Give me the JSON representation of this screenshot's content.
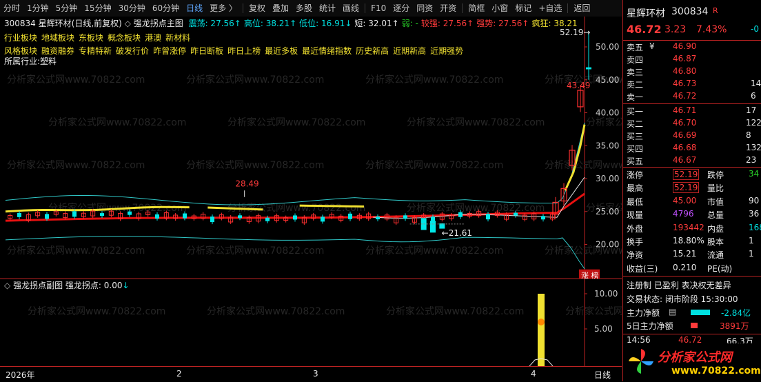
{
  "toolbar": {
    "items": [
      "分时",
      "1分钟",
      "5分钟",
      "15分钟",
      "30分钟",
      "60分钟",
      "日线",
      "更多 〉",
      "复权",
      "叠加",
      "多股",
      "统计",
      "画线",
      "F10",
      "逐分",
      "同资",
      "开资",
      "简框",
      "小窗",
      "标记",
      "+自选",
      "返回"
    ],
    "active": "日线"
  },
  "main_chart": {
    "title_code": "300834",
    "title_name": "星辉环材",
    "title_mode": "(日线,前复权)",
    "indicator_name": "强龙拐点主图",
    "legend": [
      {
        "label": "震荡:",
        "value": "27.56",
        "arrow": "↑",
        "color": "#00e0e0"
      },
      {
        "label": "高位:",
        "value": "38.21",
        "arrow": "↑",
        "color": "#00e0e0"
      },
      {
        "label": "低位:",
        "value": "16.91",
        "arrow": "↓",
        "color": "#00e0e0"
      },
      {
        "label": "短:",
        "value": "32.01",
        "arrow": "↑",
        "color": "#e8e8e8"
      },
      {
        "label": "弱:",
        "value": "-",
        "arrow": "",
        "color": "#28d028"
      },
      {
        "label": "较强:",
        "value": "27.56",
        "arrow": "↑",
        "color": "#ff3b3b"
      },
      {
        "label": "强势:",
        "value": "27.56",
        "arrow": "↑",
        "color": "#ff3b3b"
      },
      {
        "label": "疯狂:",
        "value": "38.21",
        "arrow": "",
        "color": "#f0e030"
      }
    ],
    "info_line1": [
      "行业板块",
      "地域板块",
      "东板块",
      "概念板块",
      "港澳",
      "新材料"
    ],
    "info_line2": [
      "风格板块",
      "融资融券",
      "专精特新",
      "破发行价",
      "昨曾涨停",
      "昨日断板",
      "昨日上榜",
      "最近多板",
      "最近情绪指数",
      "历史新高",
      "近期新高",
      "近期强势"
    ],
    "industry": "所属行业:塑料",
    "y_ticks": [
      "50.00",
      "45.00",
      "40.00",
      "35.00",
      "30.00",
      "25.00",
      "20.00"
    ],
    "annotations": {
      "high_label": "52.19",
      "peak1": "28.49",
      "low_label": "21.61",
      "red_label": "43.49",
      "badge": "涨 榜"
    }
  },
  "sub_chart": {
    "name": "强龙拐点副图",
    "label": "强龙拐点:",
    "value": "0.00",
    "arrow": "↓",
    "y_ticks": [
      "10.00",
      "5.00"
    ]
  },
  "time_axis": {
    "labels": [
      "2026年",
      "2",
      "3",
      "4"
    ],
    "period_button": "日线"
  },
  "watermark": "分析家公式网www.70822.com",
  "logo_text": "分析家公式网",
  "logo_url": "www.70822.com",
  "quote": {
    "name": "星辉环材",
    "code": "300834",
    "flag": "R",
    "price": "46.72",
    "change": "3.23",
    "pct": "7.43%",
    "corner": "-0",
    "asks": [
      {
        "label": "卖五",
        "mark": "¥",
        "price": "46.90",
        "vol": ""
      },
      {
        "label": "卖四",
        "mark": "",
        "price": "46.87",
        "vol": ""
      },
      {
        "label": "卖三",
        "mark": "",
        "price": "46.80",
        "vol": ""
      },
      {
        "label": "卖二",
        "mark": "",
        "price": "46.73",
        "vol": "14"
      },
      {
        "label": "卖一",
        "mark": "",
        "price": "46.72",
        "vol": "6"
      }
    ],
    "bids": [
      {
        "label": "买一",
        "price": "46.71",
        "vol": "17"
      },
      {
        "label": "买二",
        "price": "46.70",
        "vol": "122"
      },
      {
        "label": "买三",
        "price": "46.69",
        "vol": "8"
      },
      {
        "label": "买四",
        "price": "46.68",
        "vol": "132"
      },
      {
        "label": "买五",
        "price": "46.67",
        "vol": "23"
      }
    ],
    "stats": [
      {
        "l1": "涨停",
        "v1": "52.19",
        "c1": "#ff3b3b",
        "l2": "跌停",
        "v2": "34",
        "c2": "#28d028"
      },
      {
        "l1": "最高",
        "v1": "52.19",
        "c1": "#ff3b3b",
        "l2": "量比",
        "v2": "",
        "c2": "#e8e8e8"
      },
      {
        "l1": "最低",
        "v1": "45.00",
        "c1": "#ff3b3b",
        "l2": "市值",
        "v2": "90",
        "c2": "#e8e8e8"
      },
      {
        "l1": "现量",
        "v1": "4796",
        "c1": "#c050ff",
        "l2": "总量",
        "v2": "36",
        "c2": "#e8e8e8"
      },
      {
        "l1": "外盘",
        "v1": "193442",
        "c1": "#ff3b3b",
        "l2": "内盘",
        "v2": "168",
        "c2": "#00e0e0"
      },
      {
        "l1": "换手",
        "v1": "18.80%",
        "c1": "#e8e8e8",
        "l2": "股本",
        "v2": "1",
        "c2": "#e8e8e8"
      },
      {
        "l1": "净资",
        "v1": "15.21",
        "c1": "#e8e8e8",
        "l2": "流通",
        "v2": "1",
        "c2": "#e8e8e8"
      },
      {
        "l1": "收益(三)",
        "v1": "0.210",
        "c1": "#e8e8e8",
        "l2": "PE(动)",
        "v2": "",
        "c2": "#e8e8e8"
      }
    ],
    "tags": "注册制 已盈利 表决权无差异",
    "status": "交易状态: 闭市阶段 15:30:00",
    "main_flow_label": "主力净额",
    "main_flow_value": "-2.84亿",
    "flow5_label": "5日主力净额",
    "flow5_value": "3891万",
    "tick_time": "14:56",
    "tick_price": "46.72",
    "tick_vol": "66.3万"
  }
}
